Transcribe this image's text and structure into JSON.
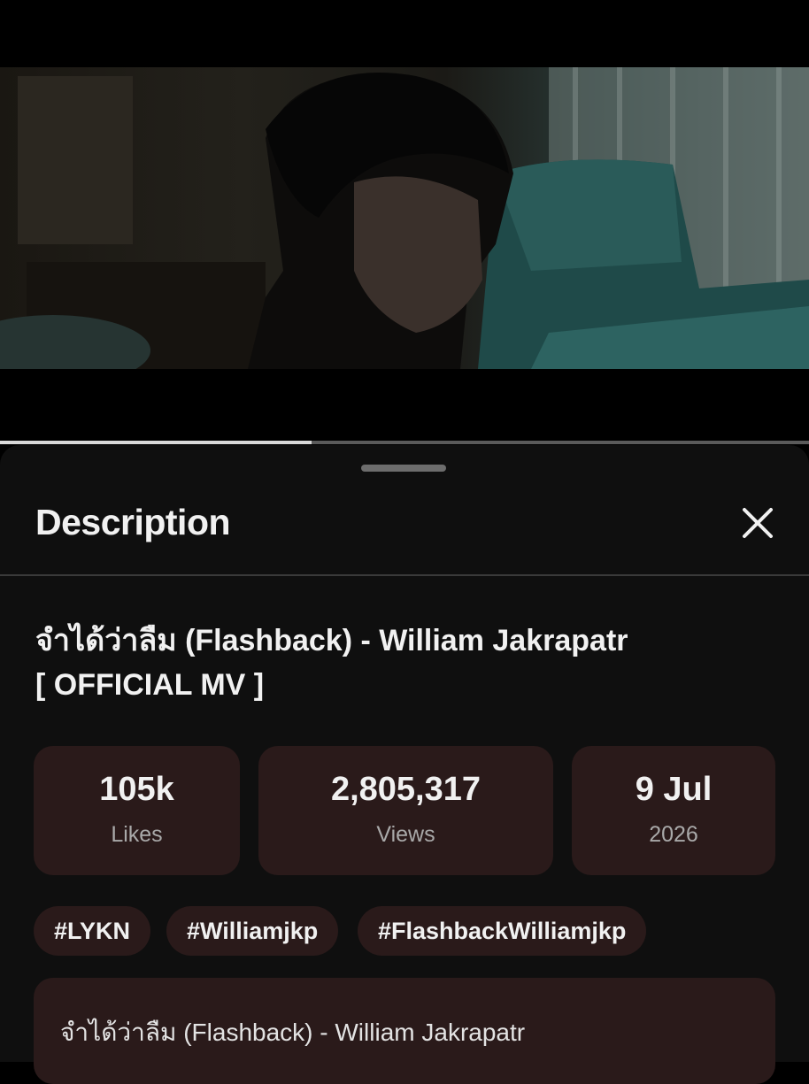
{
  "player": {
    "progress_fraction": 0.385
  },
  "sheet": {
    "title": "Description",
    "close_icon": "close-icon"
  },
  "video": {
    "title_line1": "จำได้ว่าลืม (Flashback) - William Jakrapatr",
    "title_line2": "[ OFFICIAL MV ]"
  },
  "stats": {
    "likes": {
      "value": "105k",
      "label": "Likes"
    },
    "views": {
      "value": "2,805,317",
      "label": "Views"
    },
    "date": {
      "value": "9 Jul",
      "label": "2026"
    }
  },
  "hashtags": [
    "#LYKN",
    "#Williamjkp",
    "#FlashbackWilliamjkp"
  ],
  "description": {
    "first_line": "จำได้ว่าลืม (Flashback) - William Jakrapatr"
  },
  "colors": {
    "sheet_bg": "#0f0f0f",
    "card_bg": "#2a1a1a",
    "text_primary": "#f1f1f1",
    "text_secondary": "#a9a9a9"
  }
}
